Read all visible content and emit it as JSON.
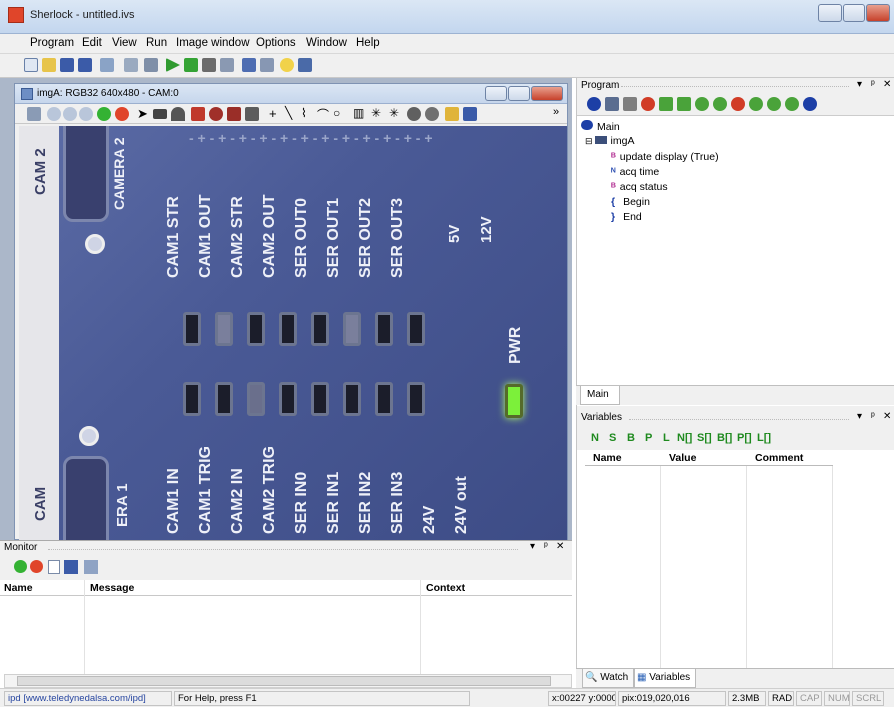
{
  "app": {
    "title": "Sherlock - untitled.ivs"
  },
  "menu": [
    "Program",
    "Edit",
    "View",
    "Run",
    "Image window",
    "Options",
    "Window",
    "Help"
  ],
  "image_window": {
    "title": "imgA: RGB32 640x480 - CAM:0"
  },
  "camera_labels": {
    "top_small": "CAM 2",
    "camera_top": "CAMERA 2",
    "outs": [
      "CAM1 STR",
      "CAM1 OUT",
      "CAM2 STR",
      "CAM2 OUT",
      "SER OUT0",
      "SER OUT1",
      "SER OUT2",
      "SER OUT3",
      "5V",
      "12V"
    ],
    "pwr": "PWR",
    "ins": [
      "CAM1 IN",
      "CAM1 TRIG",
      "CAM2 IN",
      "CAM2 TRIG",
      "SER IN0",
      "SER IN1",
      "SER IN2",
      "SER IN3",
      "24V",
      "24V out"
    ],
    "camera_bottom": "ERA 1",
    "bottom_small": "CAM"
  },
  "program": {
    "title": "Program",
    "tree": [
      {
        "label": "Main",
        "icon": "main-icon"
      },
      {
        "label": "imgA",
        "icon": "image-icon"
      },
      {
        "label": "update display (True)",
        "icon": "boolean-var-icon"
      },
      {
        "label": "acq time",
        "icon": "number-var-icon"
      },
      {
        "label": "acq status",
        "icon": "boolean-var-icon"
      },
      {
        "label": "Begin",
        "icon": "begin-icon"
      },
      {
        "label": "End",
        "icon": "end-icon"
      }
    ],
    "tab": "Main"
  },
  "variables": {
    "title": "Variables",
    "type_buttons": [
      "N",
      "S",
      "B",
      "P",
      "L",
      "N[]",
      "S[]",
      "B[]",
      "P[]",
      "L[]"
    ],
    "columns": [
      "Name",
      "Value",
      "Comment"
    ]
  },
  "bottom_tabs": [
    "Watch",
    "Variables"
  ],
  "monitor": {
    "title": "Monitor",
    "columns": [
      "Name",
      "Message",
      "Context"
    ]
  },
  "status": {
    "link": "ipd [www.teledynedalsa.com/ipd]",
    "help": "For Help, press F1",
    "coords": "x:00227 y:00000",
    "pix": "pix:019,020,016",
    "mem": "2.3MB",
    "rad": "RAD",
    "cap": "CAP",
    "num": "NUM",
    "scrl": "SCRL"
  },
  "colors": {
    "accent": "#3b5ba8",
    "led_green": "#7cf03a",
    "board_blue": "#4a5a96"
  }
}
